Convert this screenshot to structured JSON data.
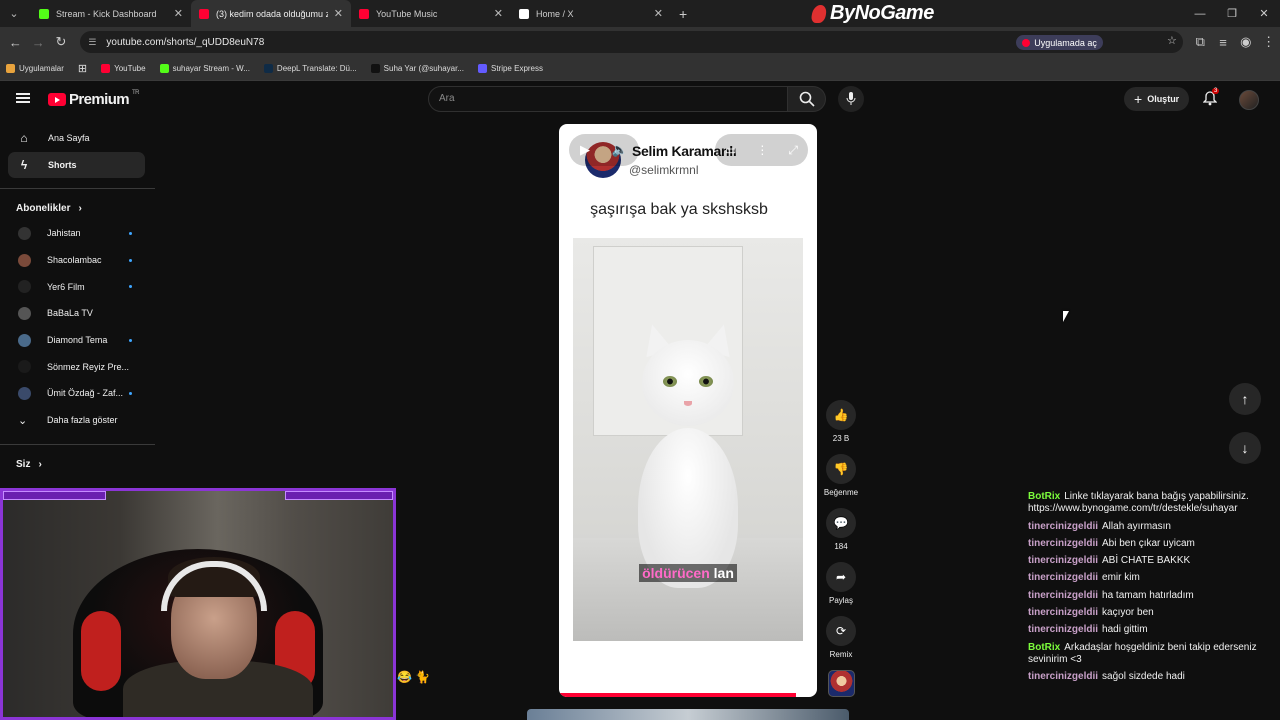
{
  "browser": {
    "tabs": [
      {
        "title": "Stream - Kick Dashboard",
        "active": false,
        "icon": "kick-icon",
        "color": "#53fc18"
      },
      {
        "title": "(3) kedim odada olduğumu zan",
        "active": true,
        "icon": "youtube-icon",
        "color": "#ff0033"
      },
      {
        "title": "YouTube Music",
        "active": false,
        "icon": "youtube-music-icon",
        "color": "#ff0033"
      },
      {
        "title": "Home / X",
        "active": false,
        "icon": "x-icon",
        "color": "#ffffff"
      }
    ],
    "url": "youtube.com/shorts/_qUDD8euN78",
    "open_in_app": "Uygulamada aç",
    "bookmarks": [
      {
        "label": "Uygulamalar",
        "color": "#e8a33d"
      },
      {
        "label": "YouTube",
        "color": "#ff0033"
      },
      {
        "label": "suhayar Stream - W...",
        "color": "#53fc18"
      },
      {
        "label": "DeepL Translate: Dü...",
        "color": "#0f2b46"
      },
      {
        "label": "Suha Yar (@suhayar...",
        "color": "#111111"
      },
      {
        "label": "Stripe Express",
        "color": "#635bff"
      }
    ]
  },
  "overlay_brand": "ByNoGame",
  "youtube": {
    "logo": "Premium",
    "logo_region": "TR",
    "search_placeholder": "Ara",
    "create_label": "Oluştur",
    "notif_count": "3",
    "nav": [
      {
        "label": "Ana Sayfa",
        "icon": "home-icon",
        "active": false
      },
      {
        "label": "Shorts",
        "icon": "shorts-icon",
        "active": true
      }
    ],
    "subs_title": "Abonelikler",
    "subs": [
      {
        "name": "Jahistan",
        "dot": true,
        "color": "#333"
      },
      {
        "name": "Shacolambac",
        "dot": true,
        "color": "#7a4a3a"
      },
      {
        "name": "Yer6 Film",
        "dot": true,
        "color": "#222"
      },
      {
        "name": "BaBaLa TV",
        "dot": false,
        "color": "#555"
      },
      {
        "name": "Diamond Tema",
        "dot": true,
        "color": "#4a6a8a"
      },
      {
        "name": "Sönmez Reyiz Pre...",
        "dot": false,
        "color": "#1a1a1a"
      },
      {
        "name": "Ümit Özdağ - Zaf...",
        "dot": true,
        "color": "#3a4a6a"
      }
    ],
    "show_more": "Daha fazla göster",
    "you_title": "Siz"
  },
  "short": {
    "channel_name": "Selim Karamanlı",
    "handle": "@selimkrmnl",
    "caption": "şaşırışa bak ya skshsksb",
    "subtitle_pre": "öldürücen",
    "subtitle_post": "lan",
    "progress": 0.92,
    "actions": [
      {
        "icon": "like-icon",
        "glyph": "👍",
        "label": "23 B"
      },
      {
        "icon": "dislike-icon",
        "glyph": "👎",
        "label": "Beğenme"
      },
      {
        "icon": "comment-icon",
        "glyph": "💬",
        "label": "184"
      },
      {
        "icon": "share-icon",
        "glyph": "➦",
        "label": "Paylaş"
      },
      {
        "icon": "remix-icon",
        "glyph": "⟳",
        "label": "Remix"
      }
    ]
  },
  "chat": [
    {
      "user": "BotRix",
      "color": "#7cfc3c",
      "text": "Linke tıklayarak bana bağış yapabilirsiniz. https://www.bynogame.com/tr/destekle/suhayar"
    },
    {
      "user": "tinercinizgeldii",
      "color": "#c8a0c8",
      "text": "Allah ayırmasın"
    },
    {
      "user": "tinercinizgeldii",
      "color": "#c8a0c8",
      "text": "Abi ben çıkar uyicam"
    },
    {
      "user": "tinercinizgeldii",
      "color": "#c8a0c8",
      "text": "ABİ CHATE BAKKK"
    },
    {
      "user": "tinercinizgeldii",
      "color": "#c8a0c8",
      "text": "emir kim"
    },
    {
      "user": "tinercinizgeldii",
      "color": "#c8a0c8",
      "text": "ha tamam hatırladım"
    },
    {
      "user": "tinercinizgeldii",
      "color": "#c8a0c8",
      "text": "kaçıyor ben"
    },
    {
      "user": "tinercinizgeldii",
      "color": "#c8a0c8",
      "text": "hadi gittim"
    },
    {
      "user": "BotRix",
      "color": "#7cfc3c",
      "text": "Arkadaşlar hoşgeldiniz beni takip ederseniz sevinirim <3"
    },
    {
      "user": "tinercinizgeldii",
      "color": "#c8a0c8",
      "text": "sağol sizdede hadi"
    }
  ]
}
